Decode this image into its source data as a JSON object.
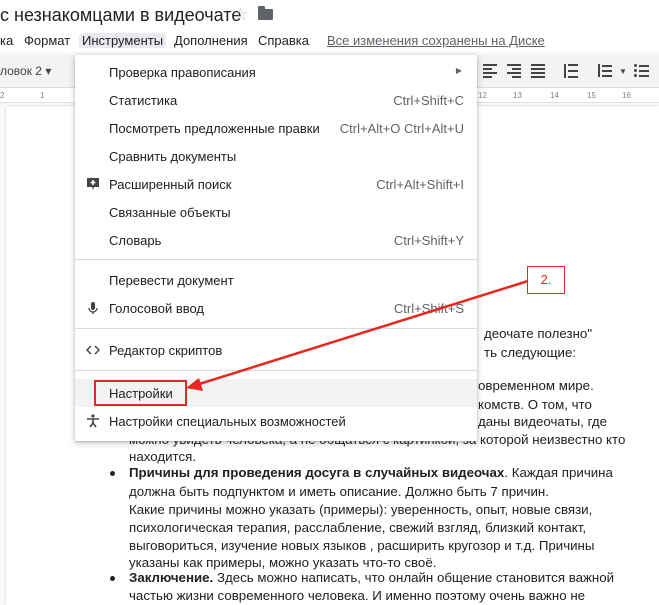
{
  "app": {
    "doc_title": "с незнакомцами в видеочате"
  },
  "menubar": {
    "items": [
      "ка",
      "Формат",
      "Инструменты",
      "Дополнения",
      "Справка"
    ],
    "saved_status": "Все изменения сохранены на Диске"
  },
  "toolbar": {
    "style_select": "ловок 2 ▾"
  },
  "ruler": {
    "ticks": [
      "2",
      "1",
      "12",
      "13",
      "14",
      "15",
      "16"
    ]
  },
  "menu": {
    "items": [
      {
        "label": "Проверка правописания",
        "shortcut": "",
        "icon": "",
        "submenu": true
      },
      {
        "label": "Статистика",
        "shortcut": "Ctrl+Shift+C",
        "icon": ""
      },
      {
        "label": "Посмотреть предложенные правки",
        "shortcut": "Ctrl+Alt+O Ctrl+Alt+U",
        "icon": ""
      },
      {
        "label": "Сравнить документы",
        "shortcut": "",
        "icon": ""
      },
      {
        "label": "Расширенный поиск",
        "shortcut": "Ctrl+Alt+Shift+I",
        "icon": "explore-plus-icon"
      },
      {
        "label": "Связанные объекты",
        "shortcut": "",
        "icon": ""
      },
      {
        "label": "Словарь",
        "shortcut": "Ctrl+Shift+Y",
        "icon": ""
      },
      {
        "label": "Перевести документ",
        "shortcut": "",
        "icon": ""
      },
      {
        "label": "Голосовой ввод",
        "shortcut": "Ctrl+Shift+S",
        "icon": "microphone-icon"
      },
      {
        "label": "Редактор скриптов",
        "shortcut": "",
        "icon": "code-icon"
      },
      {
        "label": "Настройки",
        "shortcut": "",
        "icon": ""
      },
      {
        "label": "Настройки специальных возможностей",
        "shortcut": "",
        "icon": "accessibility-icon"
      }
    ]
  },
  "annotation": {
    "label": "2."
  },
  "document": {
    "right_lines": [
      "деочате полезно\"",
      "ть следующие:",
      "овременном мире.",
      "комств. О том, что",
      "даны видеочаты, где"
    ],
    "line_bottom_partial": "можно увидеть человека, а не общаться с картинкой, за которой неизвестно кто",
    "line_nahoditsya": "находится.",
    "bullet2_bold": "Причины для проведения досуга в случайных видеочах",
    "bullet2_rest": ". Каждая причина",
    "bullet2_lines": [
      "должна быть подпунктом и иметь описание. Должно быть 7 причин.",
      "Какие причины можно указать (примеры): уверенность, опыт, новые связи,",
      "психологическая терапия, расслабление, свежий взгляд, близкий контакт,",
      "выговориться, изучение новых языков , расширить кругозор и т.д. Причины",
      "указаны как примеры, можно указать что-то своё."
    ],
    "bullet3_bold": "Заключение.",
    "bullet3_rest": " Здесь можно написать, что онлайн общение становится важной",
    "bullet3_line2": "частью жизни современного человека. И именно поэтому очень важно не"
  },
  "colors": {
    "annotation_red": "#e8281f",
    "menu_text": "#202124",
    "shortcut_text": "#5f6368"
  }
}
